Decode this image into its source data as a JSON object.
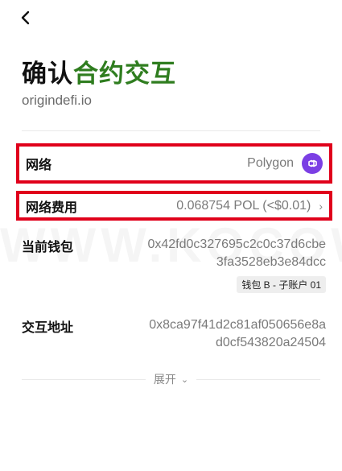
{
  "header": {
    "title_part1": "确认",
    "title_part2": "合约交互",
    "domain": "origindefi.io"
  },
  "network": {
    "label": "网络",
    "value": "Polygon",
    "icon": "polygon-logo"
  },
  "fee": {
    "label": "网络费用",
    "value": "0.068754 POL (<$0.01)"
  },
  "wallet": {
    "label": "当前钱包",
    "address": "0x42fd0c327695c2c0c37d6cbe3fa3528eb3e84dcc",
    "tag": "钱包 B - 子账户 01"
  },
  "interaction": {
    "label": "交互地址",
    "address": "0x8ca97f41d2c81af050656e8ad0cf543820a24504"
  },
  "expand": {
    "label": "展开"
  },
  "colors": {
    "accent": "#2f7d1f",
    "highlight": "#e0001b",
    "polygon": "#7b3fe4"
  }
}
